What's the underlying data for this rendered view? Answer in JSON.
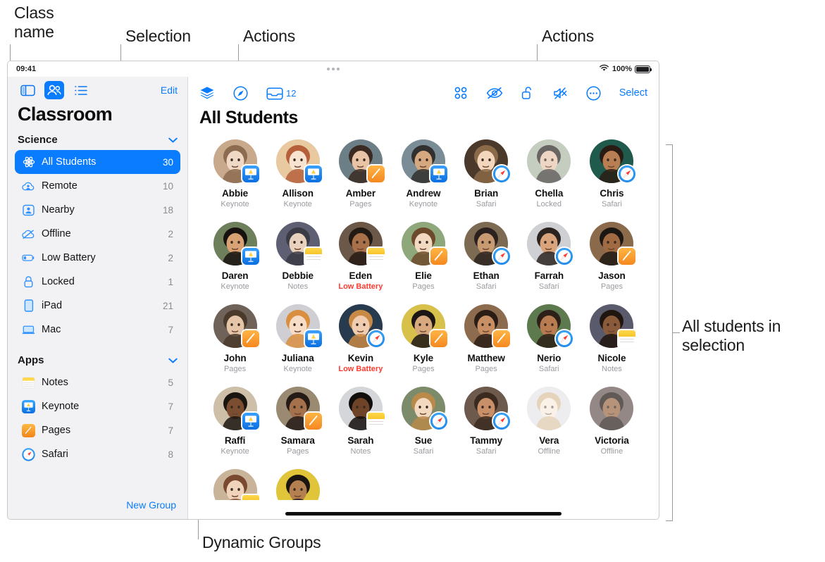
{
  "callouts": [
    {
      "id": "class-name",
      "text": "Class\nname"
    },
    {
      "id": "selection",
      "text": "Selection"
    },
    {
      "id": "actions-left",
      "text": "Actions"
    },
    {
      "id": "actions-right",
      "text": "Actions"
    },
    {
      "id": "all-students-in-selection",
      "text": "All students in\nselection"
    },
    {
      "id": "dynamic-groups",
      "text": "Dynamic Groups"
    }
  ],
  "statusbar": {
    "time": "09:41",
    "battery_percent": "100%",
    "wifi_icon": "wifi-icon",
    "battery_icon": "battery-full-icon",
    "more_dots_icon": "three-dots-icon"
  },
  "sidebar": {
    "view_icons": [
      {
        "name": "sidebar-toggle-icon",
        "active": false
      },
      {
        "name": "people-view-icon",
        "active": true
      },
      {
        "name": "list-view-icon",
        "active": false
      }
    ],
    "edit_label": "Edit",
    "title": "Classroom",
    "sections": [
      {
        "name": "Science",
        "chevron": "chevron-down-icon"
      },
      {
        "name": "Apps",
        "chevron": "chevron-down-icon"
      }
    ],
    "groups": [
      {
        "icon": "atom-icon",
        "label": "All Students",
        "count": "30",
        "selected": true
      },
      {
        "icon": "cloud-person-icon",
        "label": "Remote",
        "count": "10",
        "selected": false
      },
      {
        "icon": "person-badge-icon",
        "label": "Nearby",
        "count": "18",
        "selected": false
      },
      {
        "icon": "cloud-slash-icon",
        "label": "Offline",
        "count": "2",
        "selected": false
      },
      {
        "icon": "battery-low-icon",
        "label": "Low Battery",
        "count": "2",
        "selected": false
      },
      {
        "icon": "lock-icon",
        "label": "Locked",
        "count": "1",
        "selected": false
      },
      {
        "icon": "ipad-icon",
        "label": "iPad",
        "count": "21",
        "selected": false
      },
      {
        "icon": "mac-icon",
        "label": "Mac",
        "count": "7",
        "selected": false
      }
    ],
    "apps": [
      {
        "icon": "notes-app-icon",
        "label": "Notes",
        "count": "5"
      },
      {
        "icon": "keynote-app-icon",
        "label": "Keynote",
        "count": "7"
      },
      {
        "icon": "pages-app-icon",
        "label": "Pages",
        "count": "7"
      },
      {
        "icon": "safari-app-icon",
        "label": "Safari",
        "count": "8"
      }
    ],
    "new_group_label": "New Group"
  },
  "main": {
    "title": "All Students",
    "toolbar_left": [
      {
        "name": "layers-icon",
        "label": ""
      },
      {
        "name": "safari-navigate-icon",
        "label": ""
      },
      {
        "name": "inbox-tray-icon",
        "label": "12"
      }
    ],
    "toolbar_right": [
      {
        "name": "grid-apps-icon",
        "label": ""
      },
      {
        "name": "eye-slash-icon",
        "label": ""
      },
      {
        "name": "lock-open-icon",
        "label": ""
      },
      {
        "name": "speaker-mute-icon",
        "label": ""
      },
      {
        "name": "more-ellipsis-icon",
        "label": ""
      }
    ],
    "select_label": "Select",
    "students": [
      {
        "name": "Abbie",
        "status": "Keynote",
        "badge": "keynote",
        "state": "normal"
      },
      {
        "name": "Allison",
        "status": "Keynote",
        "badge": "keynote",
        "state": "normal"
      },
      {
        "name": "Amber",
        "status": "Pages",
        "badge": "pages",
        "state": "normal"
      },
      {
        "name": "Andrew",
        "status": "Keynote",
        "badge": "keynote",
        "state": "normal"
      },
      {
        "name": "Brian",
        "status": "Safari",
        "badge": "safari",
        "state": "normal"
      },
      {
        "name": "Chella",
        "status": "Locked",
        "badge": "none",
        "state": "dim2"
      },
      {
        "name": "Chris",
        "status": "Safari",
        "badge": "safari",
        "state": "normal"
      },
      {
        "name": "Daren",
        "status": "Keynote",
        "badge": "keynote",
        "state": "normal"
      },
      {
        "name": "Debbie",
        "status": "Notes",
        "badge": "notes",
        "state": "normal"
      },
      {
        "name": "Eden",
        "status": "Low Battery",
        "badge": "notes",
        "state": "normal"
      },
      {
        "name": "Elie",
        "status": "Pages",
        "badge": "pages",
        "state": "normal"
      },
      {
        "name": "Ethan",
        "status": "Safari",
        "badge": "safari",
        "state": "normal"
      },
      {
        "name": "Farrah",
        "status": "Safari",
        "badge": "safari",
        "state": "normal"
      },
      {
        "name": "Jason",
        "status": "Pages",
        "badge": "pages",
        "state": "normal"
      },
      {
        "name": "John",
        "status": "Pages",
        "badge": "pages",
        "state": "normal"
      },
      {
        "name": "Juliana",
        "status": "Keynote",
        "badge": "keynote",
        "state": "normal"
      },
      {
        "name": "Kevin",
        "status": "Low Battery",
        "badge": "safari",
        "state": "normal"
      },
      {
        "name": "Kyle",
        "status": "Pages",
        "badge": "pages",
        "state": "normal"
      },
      {
        "name": "Matthew",
        "status": "Pages",
        "badge": "pages",
        "state": "normal"
      },
      {
        "name": "Nerio",
        "status": "Safari",
        "badge": "safari",
        "state": "normal"
      },
      {
        "name": "Nicole",
        "status": "Notes",
        "badge": "notes",
        "state": "normal"
      },
      {
        "name": "Raffi",
        "status": "Keynote",
        "badge": "keynote",
        "state": "normal"
      },
      {
        "name": "Samara",
        "status": "Pages",
        "badge": "pages",
        "state": "normal"
      },
      {
        "name": "Sarah",
        "status": "Notes",
        "badge": "notes",
        "state": "normal"
      },
      {
        "name": "Sue",
        "status": "Safari",
        "badge": "safari",
        "state": "normal"
      },
      {
        "name": "Tammy",
        "status": "Safari",
        "badge": "safari",
        "state": "normal"
      },
      {
        "name": "Vera",
        "status": "Offline",
        "badge": "none",
        "state": "dim"
      },
      {
        "name": "Victoria",
        "status": "Offline",
        "badge": "none",
        "state": "dim2"
      },
      {
        "name": "",
        "status": "",
        "badge": "notes",
        "state": "clipped"
      },
      {
        "name": "",
        "status": "",
        "badge": "none",
        "state": "clipped"
      }
    ]
  },
  "colors": {
    "accent_blue": "#0a7cff",
    "low_battery_red": "#ff3b30",
    "sidebar_bg": "#f2f2f5",
    "muted_text": "#9a9aa0"
  }
}
